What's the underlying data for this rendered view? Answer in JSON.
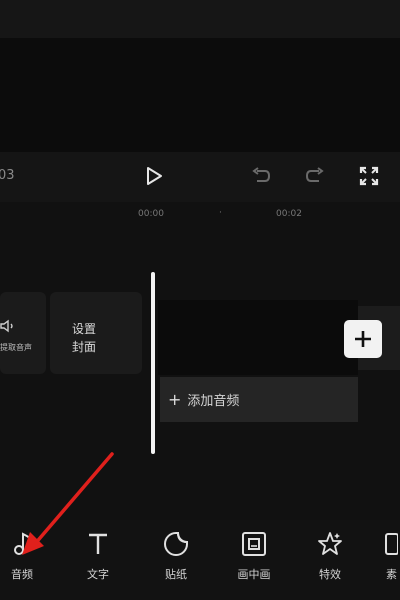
{
  "controls": {
    "time_left": "03"
  },
  "ruler": {
    "t1": "00:00",
    "t2": "00:02",
    "dot": "·"
  },
  "tracks": {
    "audio_tile_label": "提取音声",
    "cover_line1": "设置",
    "cover_line2": "封面",
    "add_audio_plus": "+",
    "add_audio_label": "添加音频",
    "add_clip_plus": "+"
  },
  "toolbar": {
    "items": [
      {
        "label": "音频",
        "icon": "music-note-icon"
      },
      {
        "label": "文字",
        "icon": "text-icon"
      },
      {
        "label": "贴纸",
        "icon": "sticker-icon"
      },
      {
        "label": "画中画",
        "icon": "picture-in-picture-icon"
      },
      {
        "label": "特效",
        "icon": "effects-star-icon"
      },
      {
        "label": "素",
        "icon": "material-icon"
      }
    ]
  },
  "colors": {
    "background": "#151515",
    "arrow": "#e0201c",
    "playhead": "#f4f4f4"
  }
}
